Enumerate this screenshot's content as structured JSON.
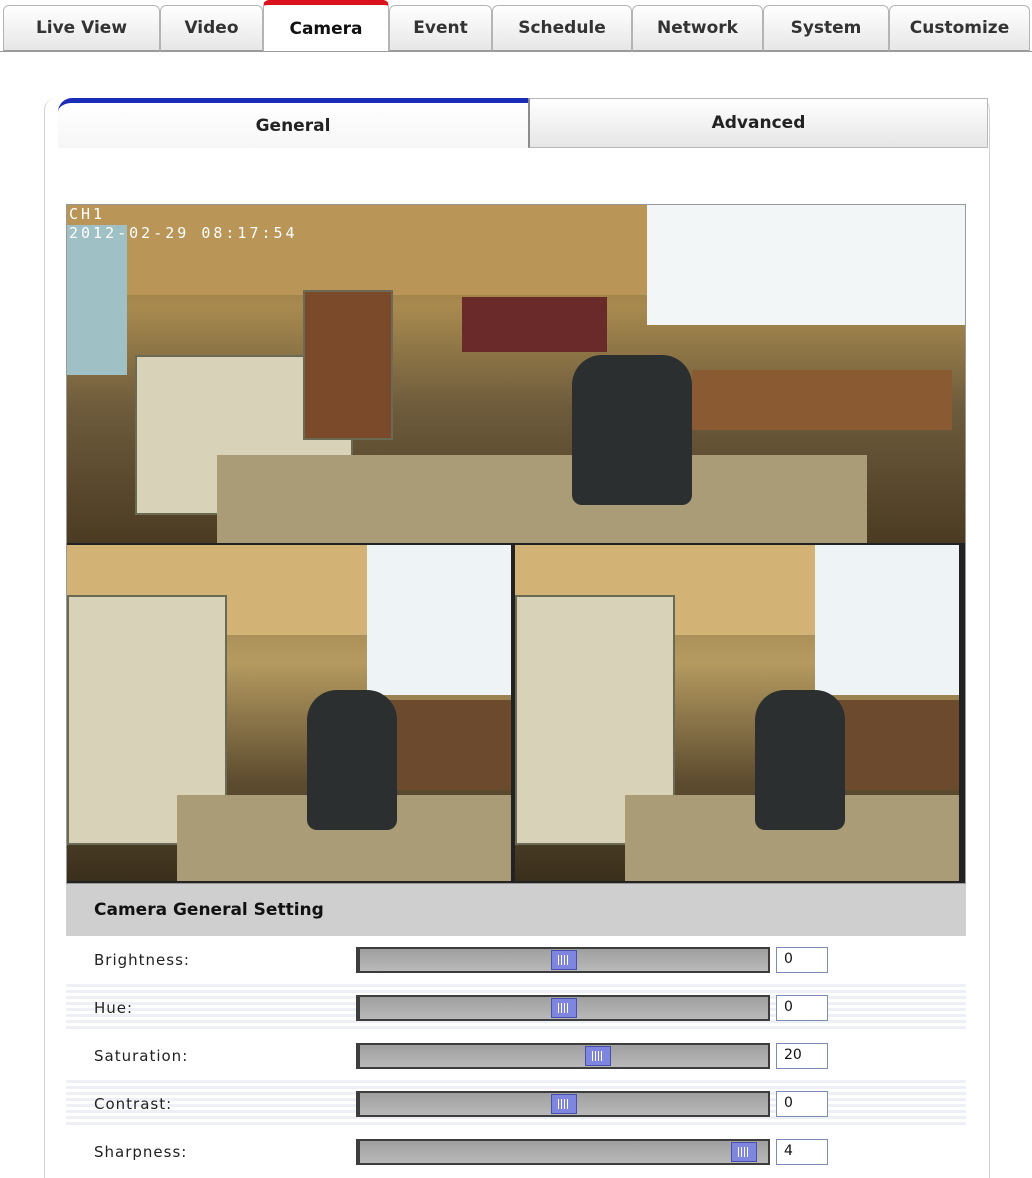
{
  "top_tabs": [
    {
      "label": "Live View"
    },
    {
      "label": "Video"
    },
    {
      "label": "Camera",
      "active": true
    },
    {
      "label": "Event"
    },
    {
      "label": "Schedule"
    },
    {
      "label": "Network"
    },
    {
      "label": "System"
    },
    {
      "label": "Customize"
    }
  ],
  "sub_tabs": {
    "general": "General",
    "advanced": "Advanced"
  },
  "video": {
    "osd_channel": "CH1",
    "osd_timestamp": "2012-02-29 08:17:54"
  },
  "settings": {
    "title": "Camera General Setting",
    "rows": [
      {
        "label": "Brightness:",
        "value": "0",
        "slider_fraction": 0.5
      },
      {
        "label": "Hue:",
        "value": "0",
        "slider_fraction": 0.5
      },
      {
        "label": "Saturation:",
        "value": "20",
        "slider_fraction": 0.59
      },
      {
        "label": "Contrast:",
        "value": "0",
        "slider_fraction": 0.5
      },
      {
        "label": "Sharpness:",
        "value": "4",
        "slider_fraction": 0.97
      }
    ]
  },
  "colors": {
    "active_tab_accent": "#d9121b",
    "subtab_accent": "#1a2bb8",
    "slider_thumb": "#7f86e0"
  }
}
